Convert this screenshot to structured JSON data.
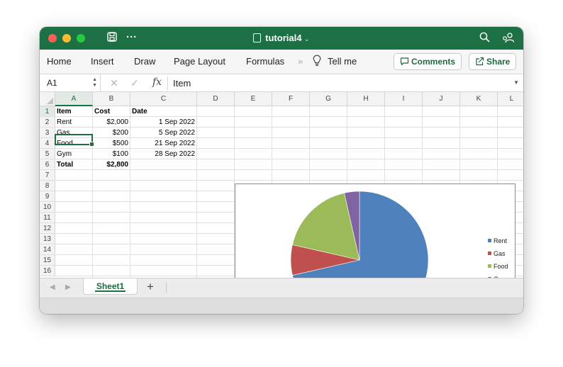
{
  "window": {
    "title": "tutorial4",
    "title_chevron": "⌄"
  },
  "ribbon": {
    "menu": [
      "Home",
      "Insert",
      "Draw",
      "Page Layout",
      "Formulas"
    ],
    "overflow": "»",
    "tell_me": "Tell me",
    "comments_label": "Comments",
    "share_label": "Share"
  },
  "formula_bar": {
    "name_box": "A1",
    "fx_label": "fx",
    "value": "Item"
  },
  "sheet": {
    "columns": [
      "A",
      "B",
      "C",
      "D",
      "E",
      "F",
      "G",
      "H",
      "I",
      "J",
      "K",
      "L"
    ],
    "rows": [
      "1",
      "2",
      "3",
      "4",
      "5",
      "6",
      "7",
      "8",
      "9",
      "10",
      "11",
      "12",
      "13",
      "14",
      "15",
      "16"
    ],
    "selected_cell": "A1",
    "cells": [
      {
        "col": "A",
        "row": 1,
        "value": "Item",
        "bold": true,
        "align": "left"
      },
      {
        "col": "B",
        "row": 1,
        "value": "Cost",
        "bold": true,
        "align": "left"
      },
      {
        "col": "C",
        "row": 1,
        "value": "Date",
        "bold": true,
        "align": "left"
      },
      {
        "col": "A",
        "row": 2,
        "value": "Rent",
        "bold": false,
        "align": "left"
      },
      {
        "col": "B",
        "row": 2,
        "value": "$2,000",
        "bold": false,
        "align": "right"
      },
      {
        "col": "C",
        "row": 2,
        "value": "1 Sep 2022",
        "bold": false,
        "align": "right"
      },
      {
        "col": "A",
        "row": 3,
        "value": "Gas",
        "bold": false,
        "align": "left"
      },
      {
        "col": "B",
        "row": 3,
        "value": "$200",
        "bold": false,
        "align": "right"
      },
      {
        "col": "C",
        "row": 3,
        "value": "5 Sep 2022",
        "bold": false,
        "align": "right"
      },
      {
        "col": "A",
        "row": 4,
        "value": "Food",
        "bold": false,
        "align": "left"
      },
      {
        "col": "B",
        "row": 4,
        "value": "$500",
        "bold": false,
        "align": "right"
      },
      {
        "col": "C",
        "row": 4,
        "value": "21 Sep 2022",
        "bold": false,
        "align": "right"
      },
      {
        "col": "A",
        "row": 5,
        "value": "Gym",
        "bold": false,
        "align": "left"
      },
      {
        "col": "B",
        "row": 5,
        "value": "$100",
        "bold": false,
        "align": "right"
      },
      {
        "col": "C",
        "row": 5,
        "value": "28 Sep 2022",
        "bold": false,
        "align": "right"
      },
      {
        "col": "A",
        "row": 6,
        "value": "Total",
        "bold": true,
        "align": "left"
      },
      {
        "col": "B",
        "row": 6,
        "value": "$2,800",
        "bold": true,
        "align": "right"
      }
    ]
  },
  "chart_data": {
    "type": "pie",
    "categories": [
      "Rent",
      "Gas",
      "Food",
      "Gym"
    ],
    "values": [
      2000,
      200,
      500,
      100
    ],
    "colors": [
      "#4f81bd",
      "#c0504d",
      "#9bbb59",
      "#8064a2"
    ],
    "legend_position": "right",
    "title": ""
  },
  "tabs": {
    "sheets": [
      "Sheet1"
    ],
    "active": "Sheet1",
    "add_label": "+",
    "prev_arrow": "◀",
    "next_arrow": "▶"
  },
  "colors": {
    "accent": "#1d7044",
    "titlebar": "#1d7044"
  }
}
